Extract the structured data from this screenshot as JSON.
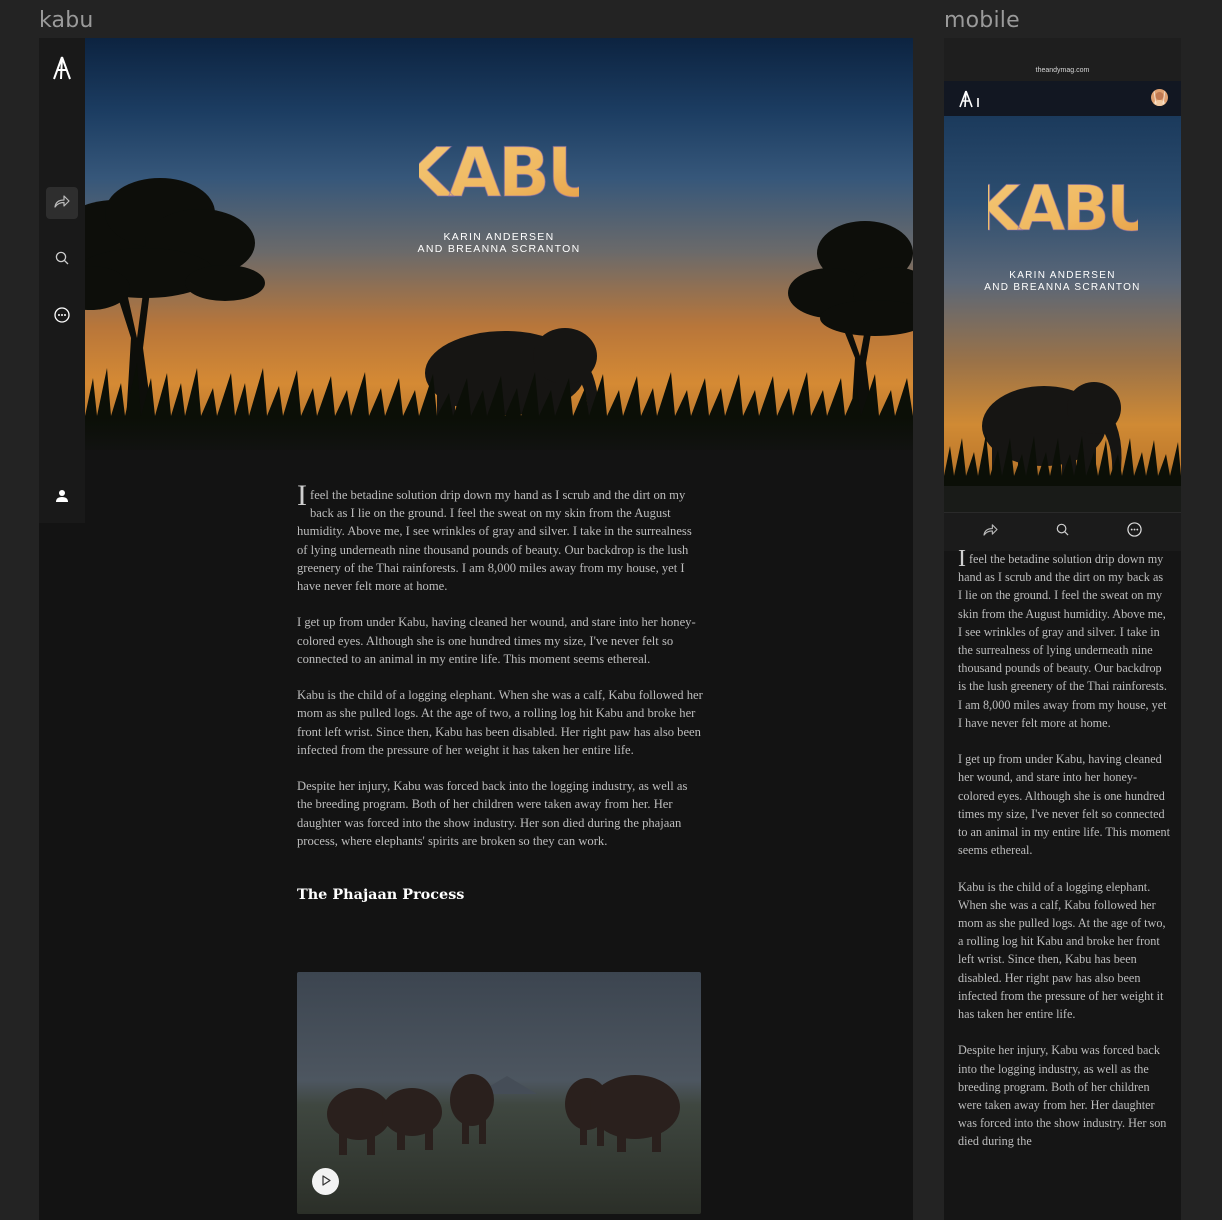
{
  "frames": {
    "desktop_label": "kabu",
    "mobile_label": "mobile"
  },
  "hero": {
    "title": "KABU",
    "authors_line1": "KARIN ANDERSEN",
    "authors_line2": "AND BREANNA SCRANTON"
  },
  "sidebar": {
    "items": [
      {
        "name": "logo",
        "icon": "andy-logo-icon"
      },
      {
        "name": "share",
        "icon": "share-icon"
      },
      {
        "name": "search",
        "icon": "search-icon"
      },
      {
        "name": "more",
        "icon": "more-icon"
      },
      {
        "name": "profile",
        "icon": "user-icon"
      }
    ]
  },
  "article": {
    "dropcap": "I",
    "para1_rest": " feel the betadine solution drip down my hand as I scrub and the dirt on my back as I lie on the ground. I feel the sweat on my skin from the August humidity. Above me, I see wrinkles of gray and silver. I take in the surrealness of lying underneath nine thousand pounds of beauty. Our backdrop is the lush greenery of the Thai rainforests. I am 8,000 miles away from my house, yet I have never felt more at home.",
    "para2": "I get up from under Kabu, having cleaned her wound, and stare into her honey-colored eyes. Although she is one hundred times my size, I've never felt so connected to an animal in my entire life. This moment seems ethereal.",
    "para3": "Kabu is the child of a logging elephant. When she was a calf, Kabu followed her mom as she pulled logs. At the age of two, a rolling log hit Kabu and broke her front left wrist. Since then, Kabu has been disabled. Her right paw has also been infected from the pressure of her weight it has taken her entire life.",
    "para4": "Despite her injury, Kabu was forced back into the logging industry, as well as the breeding program. Both of her children were taken away from her. Her daughter was forced into the show industry. Her son died during the phajaan process, where elephants' spirits are broken so they can work.",
    "section_heading": "The Phajaan Process"
  },
  "video": {
    "play_icon": "play-icon"
  },
  "mobile": {
    "url": "theandymag.com",
    "toolbar_icons": [
      "share-icon",
      "search-icon",
      "more-icon"
    ],
    "para4_truncated": "Despite her injury, Kabu was forced back into the logging industry, as well as the breeding program. Both of her children were taken away from her. Her daughter was forced into the show industry. Her son died during the"
  },
  "colors": {
    "page_bg": "#232323",
    "article_bg": "#131313",
    "title_gradient_start": "#f0c274",
    "title_gradient_end": "#e9a24a",
    "sky_top": "#0c2340",
    "sunset": "#d58a34"
  }
}
